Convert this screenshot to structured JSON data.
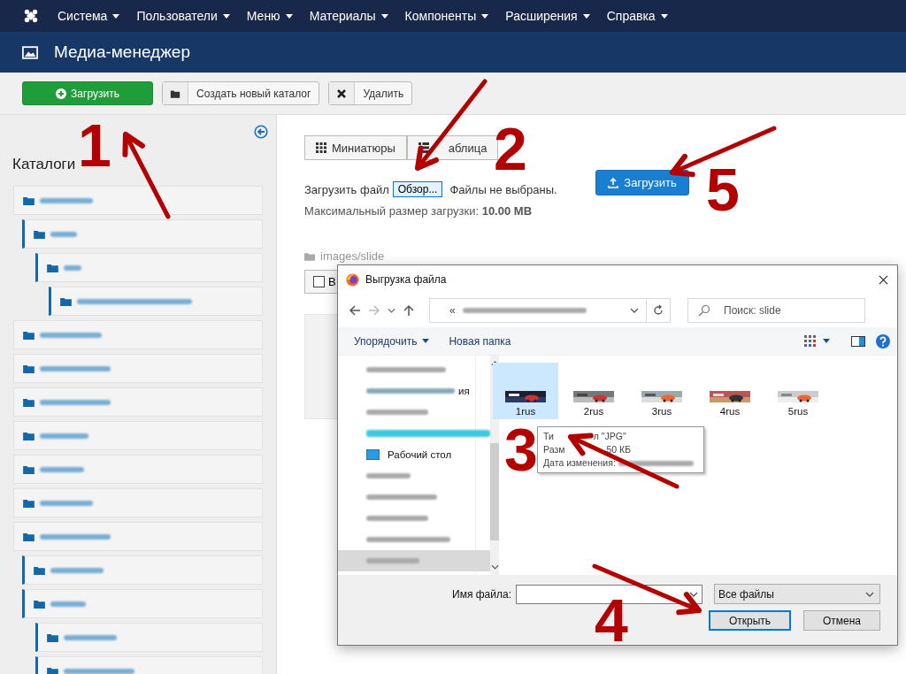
{
  "navbar": {
    "menu": [
      {
        "label": "Система"
      },
      {
        "label": "Пользователи"
      },
      {
        "label": "Меню"
      },
      {
        "label": "Материалы"
      },
      {
        "label": "Компоненты"
      },
      {
        "label": "Расширения"
      },
      {
        "label": "Справка"
      }
    ]
  },
  "header": {
    "title": "Медиа-менеджер"
  },
  "toolbar": [
    {
      "kind": "primary",
      "label": "Загрузить"
    },
    {
      "kind": "folder",
      "label": "Создать новый каталог"
    },
    {
      "kind": "delete",
      "label": "Удалить"
    }
  ],
  "sidebar": {
    "title": "Каталоги",
    "tree": [
      {
        "kind": "folder",
        "children": [
          {
            "kind": "folder",
            "children": [
              {
                "kind": "folder",
                "children": [
                  {
                    "kind": "folder"
                  }
                ]
              }
            ]
          }
        ]
      },
      {
        "kind": "folder"
      },
      {
        "kind": "folder"
      },
      {
        "kind": "folder"
      },
      {
        "kind": "folder"
      },
      {
        "kind": "folder"
      },
      {
        "kind": "folder"
      },
      {
        "kind": "folder",
        "children": [
          {
            "kind": "folder"
          },
          {
            "kind": "folder",
            "children": [
              {
                "kind": "folder"
              },
              {
                "kind": "folder"
              }
            ]
          }
        ]
      }
    ]
  },
  "view_switch": [
    {
      "kind": "grid",
      "label": "Миниатюры"
    },
    {
      "kind": "list",
      "label": "аблица"
    }
  ],
  "upload": {
    "label": "Загрузить файл",
    "browse": "Обзор...",
    "status": "Файлы не выбраны.",
    "button": "Загрузить",
    "max_size": "Максимальный размер загрузки: **10.00 MB**"
  },
  "breadcrumb": "images/slide",
  "select_all": {
    "label": "В",
    "checked": false
  },
  "dialog": {
    "title": "Выгрузка файла",
    "address": "«",
    "search_placeholder": "Поиск: slide",
    "commands": [
      {
        "kind": "menu",
        "label": "Упорядочить"
      },
      {
        "kind": "plain",
        "label": "Новая папка"
      }
    ],
    "nav_items": [
      {
        "kind": "redacted",
        "selected": false
      },
      {
        "kind": "partial",
        "label": "ия",
        "selected": false
      },
      {
        "kind": "redacted",
        "selected": false
      },
      {
        "kind": "redacted",
        "selected": false
      },
      {
        "kind": "desktop",
        "label": "Рабочий стол",
        "selected": false
      },
      {
        "kind": "redacted",
        "selected": false
      },
      {
        "kind": "redacted",
        "selected": false
      },
      {
        "kind": "redacted",
        "selected": false
      },
      {
        "kind": "redacted",
        "selected": false
      },
      {
        "kind": "redacted",
        "selected": true
      }
    ],
    "files": [
      {
        "name": "1rus",
        "selected": true,
        "kind": "picture"
      },
      {
        "name": "2rus",
        "selected": false,
        "kind": "picture"
      },
      {
        "name": "3rus",
        "selected": false,
        "kind": "picture"
      },
      {
        "name": "4rus",
        "selected": false,
        "kind": "picture"
      },
      {
        "name": "5rus",
        "selected": false,
        "kind": "picture"
      }
    ],
    "tooltip": {
      "lines": [
        {
          "kind": "text",
          "parts": [
            "Ти",
            "л \"JPG\""
          ]
        },
        {
          "kind": "text",
          "parts": [
            "Разм",
            "50 КБ"
          ]
        },
        {
          "kind": "date",
          "parts": [
            "Дата изменения:"
          ]
        }
      ]
    },
    "filename_label": "Имя файла:",
    "filetype": "Все файлы",
    "buttons": [
      {
        "kind": "default",
        "label": "Открыть"
      },
      {
        "kind": "normal",
        "label": "Отмена"
      }
    ]
  },
  "annotations": [
    {
      "label": "1"
    },
    {
      "label": "2"
    },
    {
      "label": "3"
    },
    {
      "label": "4"
    },
    {
      "label": "5"
    }
  ]
}
